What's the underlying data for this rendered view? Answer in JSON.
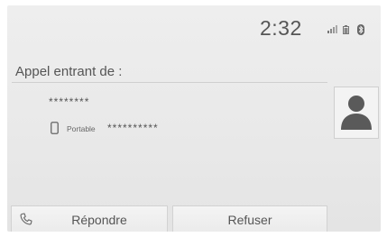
{
  "status_bar": {
    "time": "2:32",
    "icons": [
      "signal-strength-icon",
      "battery-icon",
      "bluetooth-icon"
    ]
  },
  "call": {
    "title": "Appel entrant de :",
    "caller_name": "********",
    "phone_type": "Portable",
    "phone_number": "**********",
    "avatar_icon": "contact-silhouette-icon",
    "phone_type_icon": "mobile-phone-icon"
  },
  "actions": {
    "answer_label": "Répondre",
    "answer_icon": "handset-icon",
    "decline_label": "Refuser"
  },
  "colors": {
    "background": "#e9e9e9",
    "text": "#555555",
    "divider": "#cfcfcf"
  }
}
